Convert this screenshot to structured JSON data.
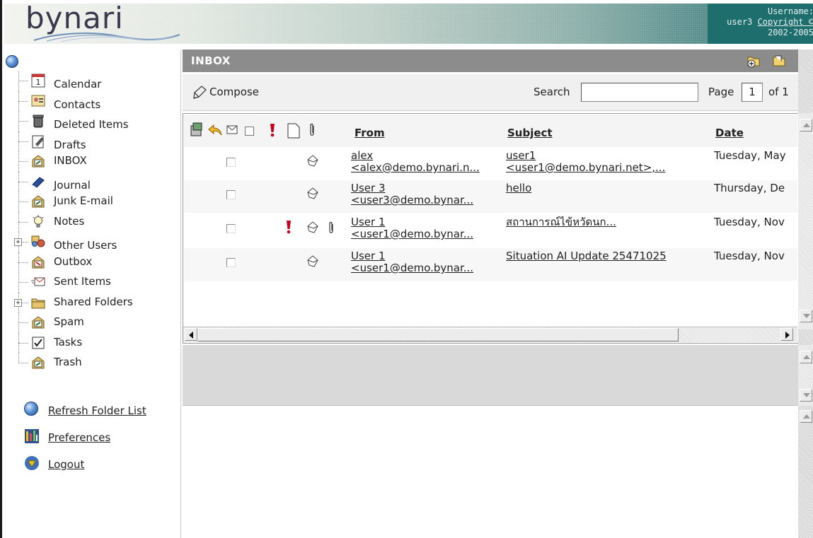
{
  "header": {
    "logo_text": "bynari",
    "userbox": {
      "line1": "Username:",
      "user": "user3",
      "copyright_link": "Copyright ©",
      "years": "2002-2005"
    }
  },
  "folders": [
    {
      "label": "Calendar",
      "icon": "calendar-icon",
      "expandable": false
    },
    {
      "label": "Contacts",
      "icon": "contacts-icon",
      "expandable": false
    },
    {
      "label": "Deleted Items",
      "icon": "trash-can-icon",
      "expandable": false
    },
    {
      "label": "Drafts",
      "icon": "drafts-icon",
      "expandable": false
    },
    {
      "label": "INBOX",
      "icon": "mail-folder-icon",
      "expandable": false
    },
    {
      "label": "Journal",
      "icon": "journal-icon",
      "expandable": false
    },
    {
      "label": "Junk E-mail",
      "icon": "mail-folder-icon",
      "expandable": false
    },
    {
      "label": "Notes",
      "icon": "lightbulb-icon",
      "expandable": false
    },
    {
      "label": "Other Users",
      "icon": "users-icon",
      "expandable": true
    },
    {
      "label": "Outbox",
      "icon": "outbox-icon",
      "expandable": false
    },
    {
      "label": "Sent Items",
      "icon": "sent-icon",
      "expandable": false
    },
    {
      "label": "Shared Folders",
      "icon": "folder-icon",
      "expandable": true
    },
    {
      "label": "Spam",
      "icon": "mail-folder-icon",
      "expandable": false
    },
    {
      "label": "Tasks",
      "icon": "checkbox-icon",
      "expandable": false
    },
    {
      "label": "Trash",
      "icon": "mail-folder-icon",
      "expandable": false
    }
  ],
  "bottom_links": {
    "refresh": "Refresh Folder List",
    "preferences": "Preferences",
    "logout": "Logout"
  },
  "inbox": {
    "title": "INBOX",
    "compose_label": "Compose",
    "search_label": "Search",
    "search_value": "",
    "page_label": "Page",
    "page_value": "1",
    "page_of": "of 1",
    "columns": {
      "from": "From",
      "subject": "Subject",
      "date": "Date"
    },
    "messages": [
      {
        "from_line1": "alex",
        "from_line2": "<alex@demo.bynari.n...",
        "subject_line1": "user1",
        "subject_line2": "<user1@demo.bynari.net>,...",
        "date": "Tuesday, May",
        "important": false,
        "attachment": false
      },
      {
        "from_line1": "User 3",
        "from_line2": "<user3@demo.bynar...",
        "subject_line1": "hello",
        "subject_line2": "",
        "date": "Thursday, De",
        "important": false,
        "attachment": false
      },
      {
        "from_line1": "User 1",
        "from_line2": "<user1@demo.bynar...",
        "subject_line1": "สถานการณ์ไข้หวัดนก...",
        "subject_line2": "",
        "date": "Tuesday, Nov",
        "important": true,
        "attachment": true
      },
      {
        "from_line1": "User 1",
        "from_line2": "<user1@demo.bynar...",
        "subject_line1": "Situation AI Update 25471025",
        "subject_line2": "",
        "date": "Tuesday, Nov",
        "important": false,
        "attachment": false
      }
    ]
  },
  "colors": {
    "inbox_bar": "#8c8c8c",
    "header_accent": "#1e6e6e",
    "priority": "#c8001e"
  }
}
